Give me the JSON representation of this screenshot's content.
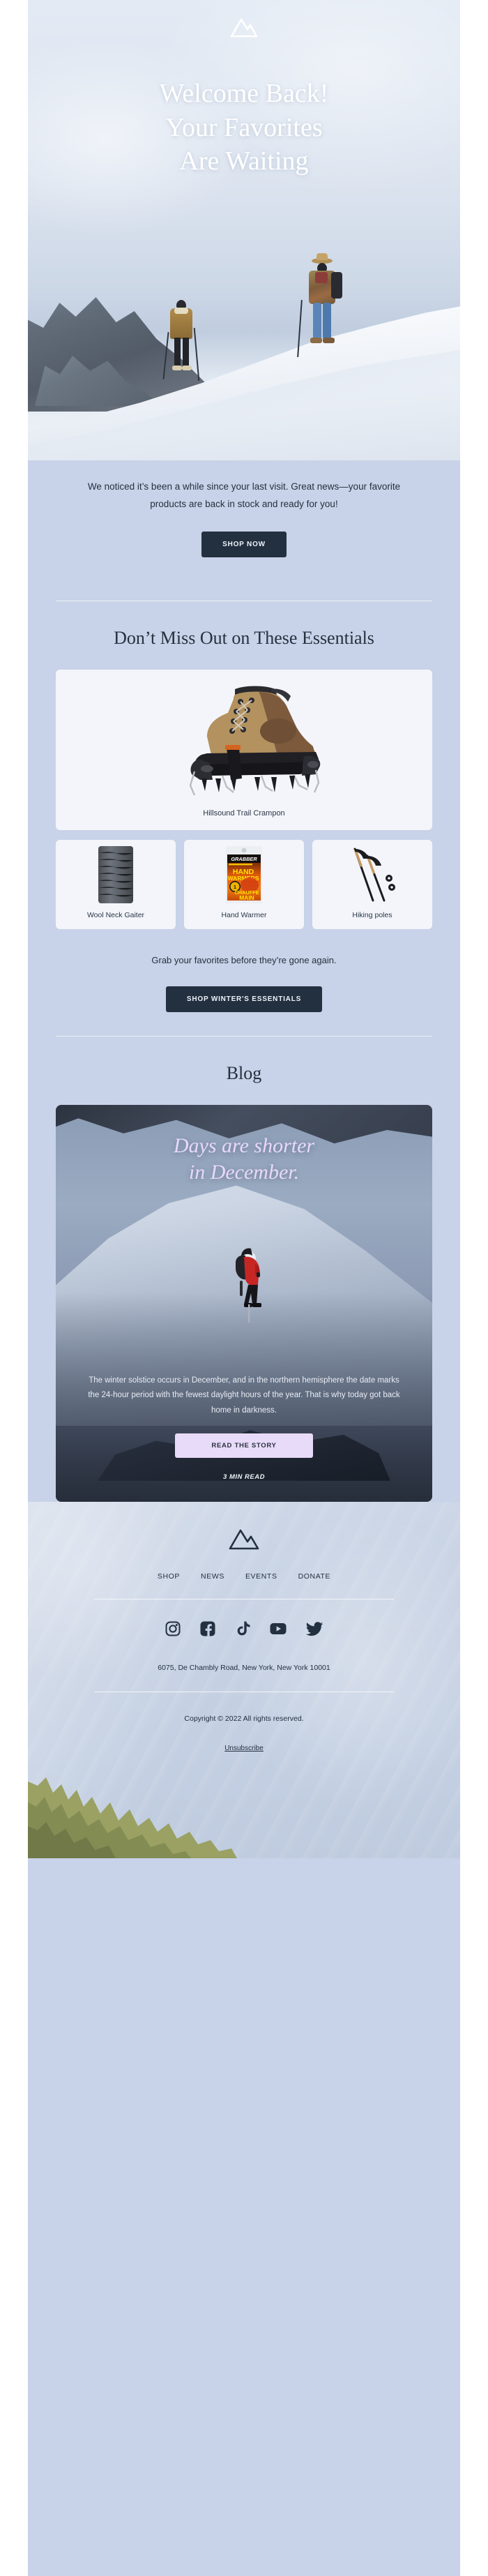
{
  "brand": {
    "logo_icon": "mountain-logo-icon"
  },
  "hero": {
    "title_line1": "Welcome Back!",
    "title_line2": "Your Favorites",
    "title_line3": "Are Waiting"
  },
  "intro": {
    "body": "We noticed it’s been a while since your last visit. Great news—your favorite products are back in stock and ready for you!",
    "cta_label": "SHOP NOW"
  },
  "products": {
    "section_title": "Don’t Miss Out on These Essentials",
    "featured": {
      "label": "Hillsound Trail Crampon",
      "image_alt": "hiking-boot-with-crampon"
    },
    "items": [
      {
        "label": "Wool Neck Gaiter",
        "image_alt": "grey-neck-gaiter"
      },
      {
        "label": "Hand Warmer",
        "image_alt": "grabber-hand-warmers-package",
        "package_brand": "GRABBER",
        "package_line1": "HAND",
        "package_line2": "WARMERS",
        "package_line3": "CHAUFFE",
        "package_line4": "MAIN",
        "package_badge": "1"
      },
      {
        "label": "Hiking poles",
        "image_alt": "pair-of-trekking-poles"
      }
    ],
    "cta_text": "Grab your favorites before they’re gone again.",
    "cta_label": "SHOP WINTER'S ESSENTIALS"
  },
  "blog": {
    "section_title": "Blog",
    "post_title_line1": "Days are shorter",
    "post_title_line2": "in December.",
    "post_body": "The winter solstice occurs in December, and in the northern hemisphere the date marks the 24-hour period with the fewest daylight hours of the year. That is why today got back home in darkness.",
    "cta_label": "READ THE STORY",
    "read_time": "3 MIN READ"
  },
  "footer": {
    "nav": [
      {
        "label": "SHOP"
      },
      {
        "label": "NEWS"
      },
      {
        "label": "EVENTS"
      },
      {
        "label": "DONATE"
      }
    ],
    "socials": [
      {
        "name": "instagram-icon"
      },
      {
        "name": "facebook-icon"
      },
      {
        "name": "tiktok-icon"
      },
      {
        "name": "youtube-icon"
      },
      {
        "name": "twitter-icon"
      }
    ],
    "address": "6075, De Chambly Road, New York, New York 10001",
    "copyright": "Copyright © 2022 All rights reserved.",
    "unsubscribe_label": "Unsubscribe"
  },
  "colors": {
    "email_background": "#c8d2e8",
    "dark_button": "#233040",
    "light_button": "#e8daf9",
    "heading_text": "#25313f",
    "blog_title_text": "#e8d8fb"
  }
}
